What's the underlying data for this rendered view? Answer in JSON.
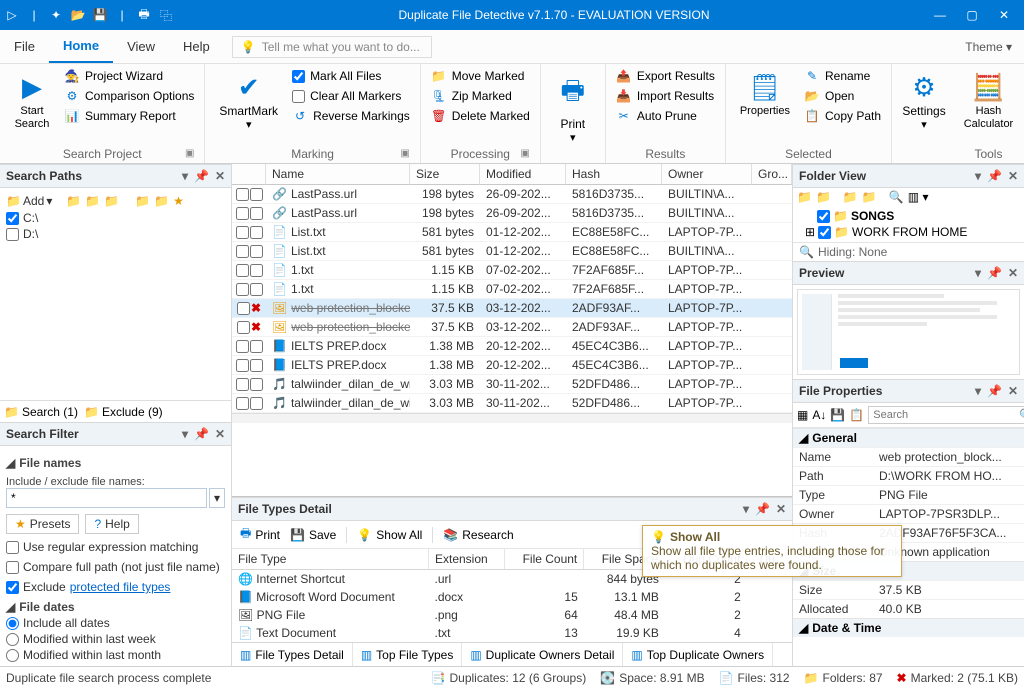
{
  "app": {
    "title": "Duplicate File Detective v7.1.70 - EVALUATION VERSION"
  },
  "menubar": {
    "tabs": [
      "File",
      "Home",
      "View",
      "Help"
    ],
    "tellme": "Tell me what you want to do...",
    "theme": "Theme"
  },
  "ribbon": {
    "search_project": {
      "label": "Search Project",
      "start": "Start\nSearch",
      "wizard": "Project Wizard",
      "comparison": "Comparison Options",
      "summary": "Summary Report"
    },
    "marking": {
      "label": "Marking",
      "smartmark": "SmartMark",
      "mark_all": "Mark All Files",
      "clear_all": "Clear All Markers",
      "reverse": "Reverse Markings"
    },
    "processing": {
      "label": "Processing",
      "move": "Move Marked",
      "zip": "Zip Marked",
      "delete": "Delete Marked"
    },
    "print": {
      "label": "Print"
    },
    "results": {
      "label": "Results",
      "export": "Export Results",
      "import": "Import Results",
      "autoprune": "Auto Prune"
    },
    "selected": {
      "label": "Selected",
      "properties": "Properties",
      "rename": "Rename",
      "open": "Open",
      "copypath": "Copy Path"
    },
    "tools": {
      "label": "Tools",
      "settings": "Settings",
      "hash": "Hash\nCalculator"
    }
  },
  "search_paths": {
    "title": "Search Paths",
    "add": "Add",
    "drives": [
      {
        "name": "C:\\",
        "checked": true
      },
      {
        "name": "D:\\",
        "checked": false
      }
    ],
    "tabs": {
      "search": "Search (1)",
      "exclude": "Exclude (9)"
    }
  },
  "search_filter": {
    "title": "Search Filter",
    "filenames": "File names",
    "include_label": "Include / exclude file names:",
    "pattern": "*",
    "presets": "Presets",
    "help": "Help",
    "useregex": "Use regular expression matching",
    "comparefull": "Compare full path (not just file name)",
    "excludeprot": "Exclude",
    "excludeprot_link": "protected file types",
    "filedates": "File dates",
    "all": "Include all dates",
    "week": "Modified within last week",
    "month": "Modified within last month"
  },
  "grid": {
    "cols": [
      "",
      "Name",
      "Size",
      "Modified",
      "Hash",
      "Owner",
      "Gro..."
    ],
    "rows": [
      {
        "mark": "",
        "ico": "🔗",
        "name": "LastPass.url",
        "size": "198 bytes",
        "mod": "26-09-202...",
        "hash": "5816D3735...",
        "owner": "BUILTIN\\A..."
      },
      {
        "mark": "",
        "ico": "🔗",
        "name": "LastPass.url",
        "size": "198 bytes",
        "mod": "26-09-202...",
        "hash": "5816D3735...",
        "owner": "BUILTIN\\A..."
      },
      {
        "mark": "",
        "ico": "📄",
        "name": "List.txt",
        "size": "581 bytes",
        "mod": "01-12-202...",
        "hash": "EC88E58FC...",
        "owner": "LAPTOP-7P..."
      },
      {
        "mark": "",
        "ico": "📄",
        "name": "List.txt",
        "size": "581 bytes",
        "mod": "01-12-202...",
        "hash": "EC88E58FC...",
        "owner": "BUILTIN\\A..."
      },
      {
        "mark": "",
        "ico": "📄",
        "name": "1.txt",
        "size": "1.15 KB",
        "mod": "07-02-202...",
        "hash": "7F2AF685F...",
        "owner": "LAPTOP-7P..."
      },
      {
        "mark": "",
        "ico": "📄",
        "name": "1.txt",
        "size": "1.15 KB",
        "mod": "07-02-202...",
        "hash": "7F2AF685F...",
        "owner": "LAPTOP-7P..."
      },
      {
        "mark": "x",
        "ico": "🖼",
        "name": "web protection_blocked dom...",
        "size": "37.5 KB",
        "mod": "03-12-202...",
        "hash": "2ADF93AF...",
        "owner": "LAPTOP-7P...",
        "selected": true,
        "struck": true
      },
      {
        "mark": "x",
        "ico": "🖼",
        "name": "web protection_blocked dom...",
        "size": "37.5 KB",
        "mod": "03-12-202...",
        "hash": "2ADF93AF...",
        "owner": "LAPTOP-7P...",
        "struck": true
      },
      {
        "mark": "",
        "ico": "📘",
        "name": "IELTS PREP.docx",
        "size": "1.38 MB",
        "mod": "20-12-202...",
        "hash": "45EC4C3B6...",
        "owner": "LAPTOP-7P..."
      },
      {
        "mark": "",
        "ico": "📘",
        "name": "IELTS PREP.docx",
        "size": "1.38 MB",
        "mod": "20-12-202...",
        "hash": "45EC4C3B6...",
        "owner": "LAPTOP-7P..."
      },
      {
        "mark": "",
        "ico": "🎵",
        "name": "talwiinder_dilan_de_wich_pro...",
        "size": "3.03 MB",
        "mod": "30-11-202...",
        "hash": "52DFD486...",
        "owner": "LAPTOP-7P..."
      },
      {
        "mark": "",
        "ico": "🎵",
        "name": "talwiinder_dilan_de_wich_pro...",
        "size": "3.03 MB",
        "mod": "30-11-202...",
        "hash": "52DFD486...",
        "owner": "LAPTOP-7P..."
      }
    ]
  },
  "ftd": {
    "title": "File Types Detail",
    "print": "Print",
    "save": "Save",
    "showall": "Show All",
    "research": "Research",
    "cols": [
      "File Type",
      "Extension",
      "File Count",
      "File Space",
      "Dup Count",
      "Du..."
    ],
    "rows": [
      {
        "ico": "🌐",
        "type": "Internet Shortcut",
        "ext": ".url",
        "count": "",
        "space": "844 bytes",
        "dup": "2"
      },
      {
        "ico": "📘",
        "type": "Microsoft Word Document",
        "ext": ".docx",
        "count": "15",
        "space": "13.1 MB",
        "dup": "2"
      },
      {
        "ico": "🖼",
        "type": "PNG File",
        "ext": ".png",
        "count": "64",
        "space": "48.4 MB",
        "dup": "2"
      },
      {
        "ico": "📄",
        "type": "Text Document",
        "ext": ".txt",
        "count": "13",
        "space": "19.9 KB",
        "dup": "4"
      }
    ],
    "tabs": [
      "File Types Detail",
      "Top File Types",
      "Duplicate Owners Detail",
      "Top Duplicate Owners"
    ],
    "tooltip": {
      "title": "Show All",
      "body": "Show all file type entries, including those for which no duplicates were found."
    }
  },
  "folder_view": {
    "title": "Folder View",
    "songs": "SONGS",
    "wfh": "WORK FROM HOME",
    "hiding": "Hiding: None"
  },
  "preview": {
    "title": "Preview"
  },
  "file_props": {
    "title": "File Properties",
    "search_placeholder": "Search",
    "general": "General",
    "rows_general": [
      [
        "Name",
        "web protection_block..."
      ],
      [
        "Path",
        "D:\\WORK FROM HO..."
      ],
      [
        "Type",
        "PNG File"
      ],
      [
        "Owner",
        "LAPTOP-7PSR3DLP..."
      ],
      [
        "Hash",
        "2ADF93AF76F5F3CA..."
      ],
      [
        "Opens with",
        "Unknown application"
      ]
    ],
    "size": "Size",
    "rows_size": [
      [
        "Size",
        "37.5 KB"
      ],
      [
        "Allocated",
        "40.0 KB"
      ]
    ],
    "datetime": "Date & Time"
  },
  "statusbar": {
    "msg": "Duplicate file search process complete",
    "dups": "Duplicates: 12 (6 Groups)",
    "space": "Space: 8.91 MB",
    "files": "Files: 312",
    "folders": "Folders: 87",
    "marked": "Marked: 2 (75.1 KB)"
  }
}
